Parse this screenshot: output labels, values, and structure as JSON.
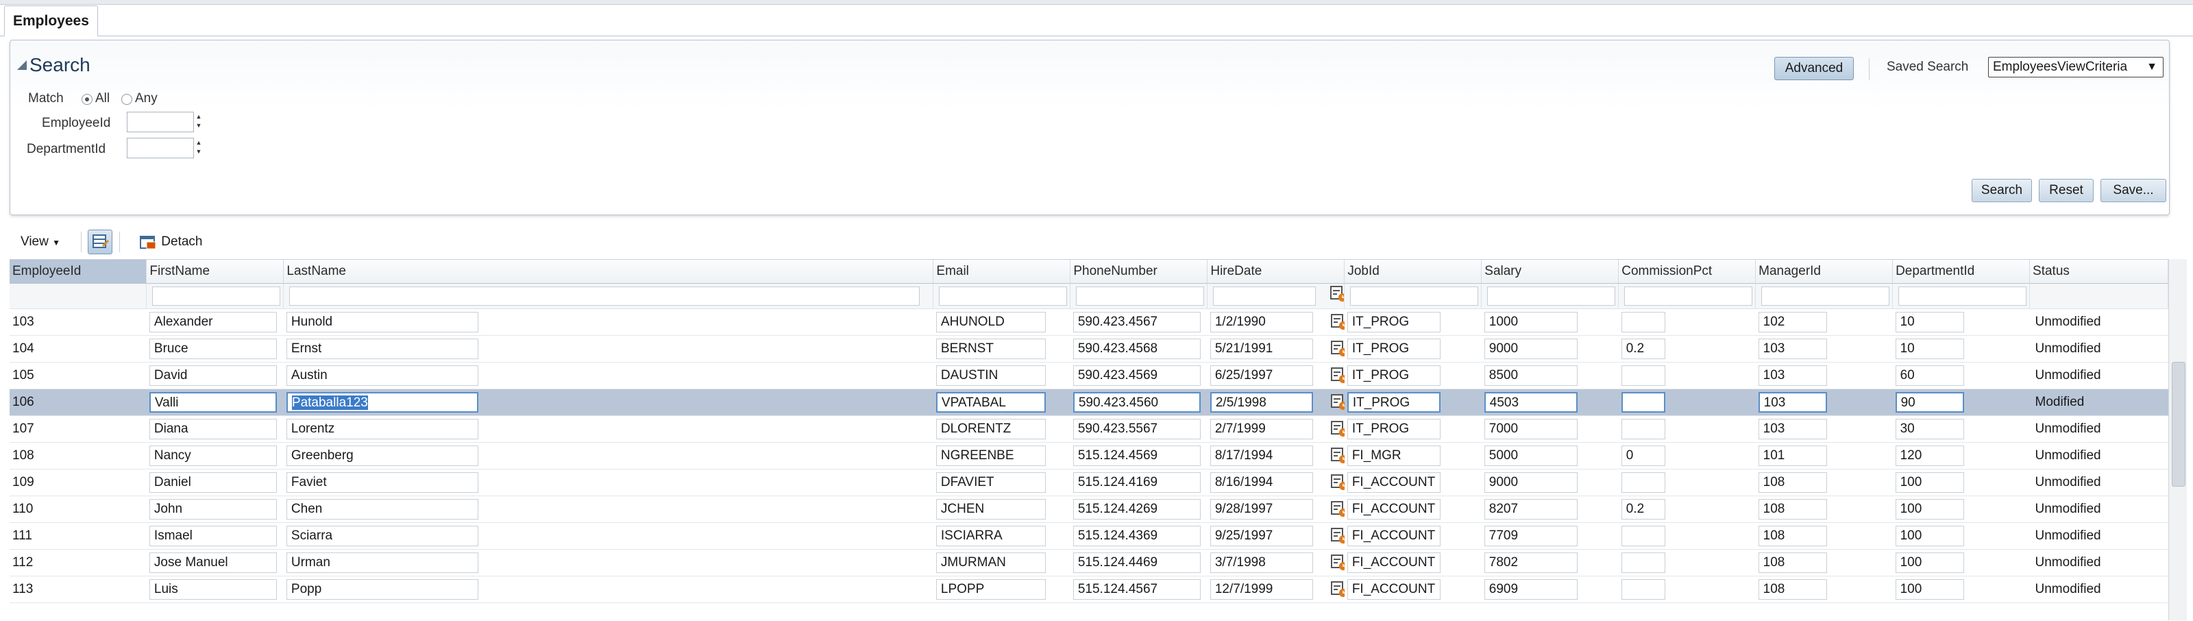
{
  "tab": {
    "label": "Employees"
  },
  "search": {
    "title": "Search",
    "match_label": "Match",
    "match_all": "All",
    "match_any": "Any",
    "employee_id_label": "EmployeeId",
    "department_id_label": "DepartmentId",
    "advanced_label": "Advanced",
    "saved_search_label": "Saved Search",
    "saved_search_value": "EmployeesViewCriteria",
    "search_button": "Search",
    "reset_button": "Reset",
    "save_button": "Save..."
  },
  "toolbar": {
    "view_label": "View",
    "detach_label": "Detach"
  },
  "table": {
    "columns": [
      "EmployeeId",
      "FirstName",
      "LastName",
      "Email",
      "PhoneNumber",
      "HireDate",
      "JobId",
      "Salary",
      "CommissionPct",
      "ManagerId",
      "DepartmentId",
      "Status"
    ],
    "rows": [
      {
        "EmployeeId": "103",
        "FirstName": "Alexander",
        "LastName": "Hunold",
        "Email": "AHUNOLD",
        "PhoneNumber": "590.423.4567",
        "HireDate": "1/2/1990",
        "JobId": "IT_PROG",
        "Salary": "1000",
        "CommissionPct": "",
        "ManagerId": "102",
        "DepartmentId": "10",
        "Status": "Unmodified"
      },
      {
        "EmployeeId": "104",
        "FirstName": "Bruce",
        "LastName": "Ernst",
        "Email": "BERNST",
        "PhoneNumber": "590.423.4568",
        "HireDate": "5/21/1991",
        "JobId": "IT_PROG",
        "Salary": "9000",
        "CommissionPct": "0.2",
        "ManagerId": "103",
        "DepartmentId": "10",
        "Status": "Unmodified"
      },
      {
        "EmployeeId": "105",
        "FirstName": "David",
        "LastName": "Austin",
        "Email": "DAUSTIN",
        "PhoneNumber": "590.423.4569",
        "HireDate": "6/25/1997",
        "JobId": "IT_PROG",
        "Salary": "8500",
        "CommissionPct": "",
        "ManagerId": "103",
        "DepartmentId": "60",
        "Status": "Unmodified"
      },
      {
        "EmployeeId": "106",
        "FirstName": "Valli",
        "LastName": "Pataballa123",
        "Email": "VPATABAL",
        "PhoneNumber": "590.423.4560",
        "HireDate": "2/5/1998",
        "JobId": "IT_PROG",
        "Salary": "4503",
        "CommissionPct": "",
        "ManagerId": "103",
        "DepartmentId": "90",
        "Status": "Modified",
        "selected": true
      },
      {
        "EmployeeId": "107",
        "FirstName": "Diana",
        "LastName": "Lorentz",
        "Email": "DLORENTZ",
        "PhoneNumber": "590.423.5567",
        "HireDate": "2/7/1999",
        "JobId": "IT_PROG",
        "Salary": "7000",
        "CommissionPct": "",
        "ManagerId": "103",
        "DepartmentId": "30",
        "Status": "Unmodified"
      },
      {
        "EmployeeId": "108",
        "FirstName": "Nancy",
        "LastName": "Greenberg",
        "Email": "NGREENBE",
        "PhoneNumber": "515.124.4569",
        "HireDate": "8/17/1994",
        "JobId": "FI_MGR",
        "Salary": "5000",
        "CommissionPct": "0",
        "ManagerId": "101",
        "DepartmentId": "120",
        "Status": "Unmodified"
      },
      {
        "EmployeeId": "109",
        "FirstName": "Daniel",
        "LastName": "Faviet",
        "Email": "DFAVIET",
        "PhoneNumber": "515.124.4169",
        "HireDate": "8/16/1994",
        "JobId": "FI_ACCOUNT",
        "Salary": "9000",
        "CommissionPct": "",
        "ManagerId": "108",
        "DepartmentId": "100",
        "Status": "Unmodified"
      },
      {
        "EmployeeId": "110",
        "FirstName": "John",
        "LastName": "Chen",
        "Email": "JCHEN",
        "PhoneNumber": "515.124.4269",
        "HireDate": "9/28/1997",
        "JobId": "FI_ACCOUNT",
        "Salary": "8207",
        "CommissionPct": "0.2",
        "ManagerId": "108",
        "DepartmentId": "100",
        "Status": "Unmodified"
      },
      {
        "EmployeeId": "111",
        "FirstName": "Ismael",
        "LastName": "Sciarra",
        "Email": "ISCIARRA",
        "PhoneNumber": "515.124.4369",
        "HireDate": "9/25/1997",
        "JobId": "FI_ACCOUNT",
        "Salary": "7709",
        "CommissionPct": "",
        "ManagerId": "108",
        "DepartmentId": "100",
        "Status": "Unmodified"
      },
      {
        "EmployeeId": "112",
        "FirstName": "Jose Manuel",
        "LastName": "Urman",
        "Email": "JMURMAN",
        "PhoneNumber": "515.124.4469",
        "HireDate": "3/7/1998",
        "JobId": "FI_ACCOUNT",
        "Salary": "7802",
        "CommissionPct": "",
        "ManagerId": "108",
        "DepartmentId": "100",
        "Status": "Unmodified"
      },
      {
        "EmployeeId": "113",
        "FirstName": "Luis",
        "LastName": "Popp",
        "Email": "LPOPP",
        "PhoneNumber": "515.124.4567",
        "HireDate": "12/7/1999",
        "JobId": "FI_ACCOUNT",
        "Salary": "6909",
        "CommissionPct": "",
        "ManagerId": "108",
        "DepartmentId": "100",
        "Status": "Unmodified"
      }
    ]
  },
  "colors": {
    "selected_row": "#b9c6d7",
    "header_sorted": "#b7c6d8",
    "accent": "#3b7bc8"
  },
  "icons": [
    "collapse-triangle-icon",
    "view-dropdown-icon",
    "table-toolbar-icon",
    "detach-icon",
    "calendar-icon",
    "spin-up-icon",
    "spin-down-icon",
    "select-dropdown-icon"
  ]
}
